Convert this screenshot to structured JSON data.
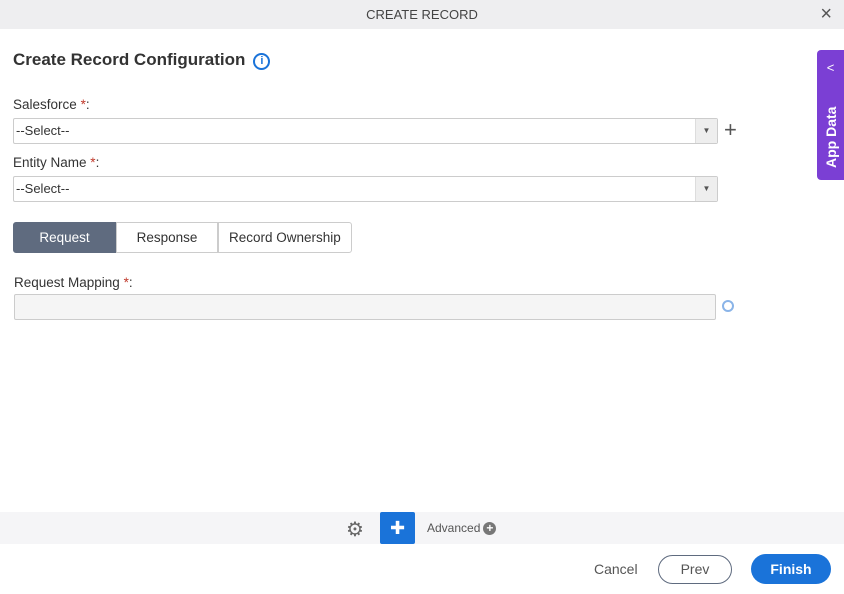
{
  "dialog": {
    "title": "CREATE RECORD",
    "close": "×"
  },
  "heading": "Create Record Configuration",
  "fields": {
    "salesforce": {
      "label": "Salesforce",
      "value": "--Select--"
    },
    "entity": {
      "label": "Entity Name",
      "value": "--Select--"
    },
    "mapping": {
      "label": "Request Mapping",
      "value": ""
    }
  },
  "required_mark": "*",
  "tabs": [
    {
      "label": "Request",
      "active": true
    },
    {
      "label": "Response"
    },
    {
      "label": "Record Ownership"
    }
  ],
  "app_data": "App Data",
  "toolbar": {
    "advanced": "Advanced"
  },
  "buttons": {
    "cancel": "Cancel",
    "prev": "Prev",
    "finish": "Finish"
  },
  "colors": {
    "accent": "#1a73d9",
    "app_data": "#7b3fd4",
    "active_tab": "#5f6b7f"
  }
}
